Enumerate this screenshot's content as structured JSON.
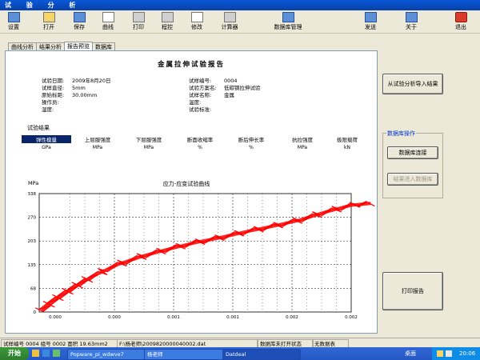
{
  "window": {
    "title": "试 验 分 析"
  },
  "toolbar": [
    {
      "label": "设置",
      "icon": "settings-icon"
    },
    {
      "label": "打开",
      "icon": "open-folder-icon"
    },
    {
      "label": "保存",
      "icon": "save-icon"
    },
    {
      "label": "曲线",
      "icon": "curve-icon"
    },
    {
      "label": "打印",
      "icon": "print-icon"
    },
    {
      "label": "程控",
      "icon": "program-control-icon"
    },
    {
      "label": "修改",
      "icon": "edit-icon"
    },
    {
      "label": "计算器",
      "icon": "calculator-icon"
    },
    {
      "label": "数据库管理",
      "icon": "database-icon"
    },
    {
      "label": "发送",
      "icon": "send-icon"
    },
    {
      "label": "关于",
      "icon": "about-icon"
    },
    {
      "label": "退出",
      "icon": "exit-icon"
    }
  ],
  "tabs": [
    "曲线分析",
    "结果分析",
    "报告预览",
    "数据库"
  ],
  "active_tab": "报告预览",
  "report": {
    "title": "金属拉伸试验报告",
    "left": [
      {
        "k": "试验日期:",
        "v": "2009年8月20日"
      },
      {
        "k": "试样直径:",
        "v": "5mm"
      },
      {
        "k": "原始标距:",
        "v": "30.00mm"
      },
      {
        "k": "操作员:",
        "v": ""
      },
      {
        "k": "湿度:",
        "v": ""
      }
    ],
    "right": [
      {
        "k": "试样编号:",
        "v": "0004"
      },
      {
        "k": "试验方案名:",
        "v": "低碳钢拉伸试验"
      },
      {
        "k": "试样名称:",
        "v": "金属"
      },
      {
        "k": "温度:",
        "v": ""
      },
      {
        "k": "试验标准:",
        "v": ""
      }
    ],
    "results_label": "试验结果",
    "results": [
      {
        "name": "弹性模量",
        "unit": "GPa"
      },
      {
        "name": "上屈服强度",
        "unit": "MPa"
      },
      {
        "name": "下屈服强度",
        "unit": "MPa"
      },
      {
        "name": "断面收缩率",
        "unit": "%"
      },
      {
        "name": "断后伸长率",
        "unit": "%"
      },
      {
        "name": "抗拉强度",
        "unit": "MPa"
      },
      {
        "name": "极限载荷",
        "unit": "kN"
      }
    ]
  },
  "chart_data": {
    "type": "line",
    "title": "应力-应变试验曲线",
    "ylabel": "MPa",
    "xlabel": "",
    "xlim": [
      -0.0004,
      0.002
    ],
    "ylim": [
      0,
      338
    ],
    "xticks": [
      "0.000",
      "0.000",
      "0.001",
      "0.001",
      "0.002",
      "0.002"
    ],
    "yticks": [
      "0",
      "68",
      "135",
      "203",
      "270",
      "338"
    ],
    "grid": true,
    "series": [
      {
        "name": "",
        "color": "#ff0000",
        "x": [
          -0.00038,
          -0.0003,
          -0.0002,
          -0.0001,
          0.0,
          0.0002,
          0.0004,
          0.0006,
          0.0008,
          0.001,
          0.0012,
          0.0014,
          0.0016,
          0.0018,
          0.002,
          0.00215
        ],
        "y": [
          5,
          30,
          55,
          78,
          100,
          135,
          160,
          180,
          198,
          213,
          230,
          245,
          262,
          285,
          305,
          310
        ]
      }
    ]
  },
  "sidebar": {
    "import_button": "从试验分析导入结果",
    "db_group_label": "数据库操作",
    "db_connect": "数据库连接",
    "db_import": "结果进入数据库",
    "print_report": "打印报告"
  },
  "statusbar": [
    "试样编号 0004 组号 0002 面积 19.63mm2",
    "F:\\杨老师\\2009820000040002.dat",
    "数据库未打开状态",
    "无数据表"
  ],
  "taskbar": {
    "start": "开始",
    "tasks": [
      {
        "label": "Popware_pi_wdwve7"
      },
      {
        "label": "杨老师"
      },
      {
        "label": "Datdeal",
        "active": true
      }
    ],
    "tray_label": "桌面",
    "clock": "20:06"
  }
}
